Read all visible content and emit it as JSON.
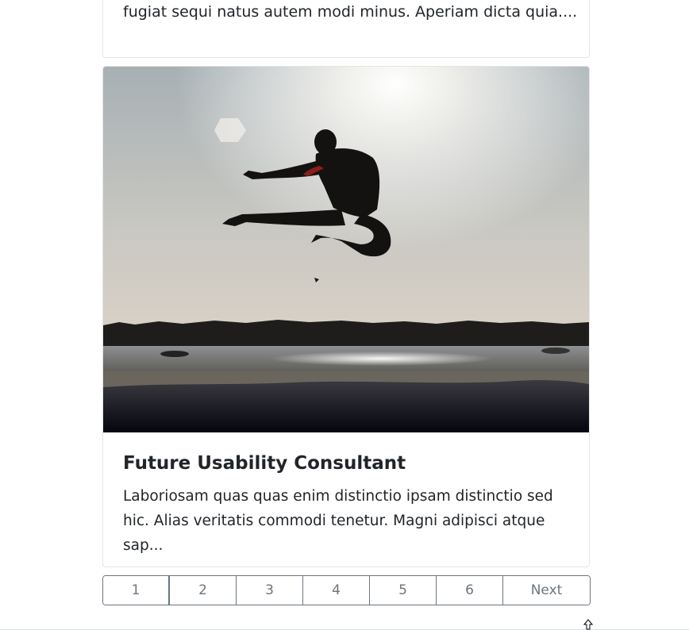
{
  "previous_card": {
    "excerpt": "fugiat sequi natus autem modi minus. Aperiam dicta quia...."
  },
  "card": {
    "image_alt": "Silhouette of a man doing a flying kick over a beach at sunset",
    "title": "Future Usability Consultant",
    "excerpt": "Laboriosam quas quas enim distinctio ipsam distinctio sed hic. Alias veritatis commodi tenetur. Magni adipisci atque sap..."
  },
  "pagination": {
    "pages": [
      "1",
      "2",
      "3",
      "4",
      "5",
      "6"
    ],
    "next_label": "Next"
  },
  "colors": {
    "text": "#212529",
    "muted": "#6c757d",
    "card_border": "#e3e4e6"
  },
  "icons": {
    "cursor": "arrow-cursor-icon"
  }
}
